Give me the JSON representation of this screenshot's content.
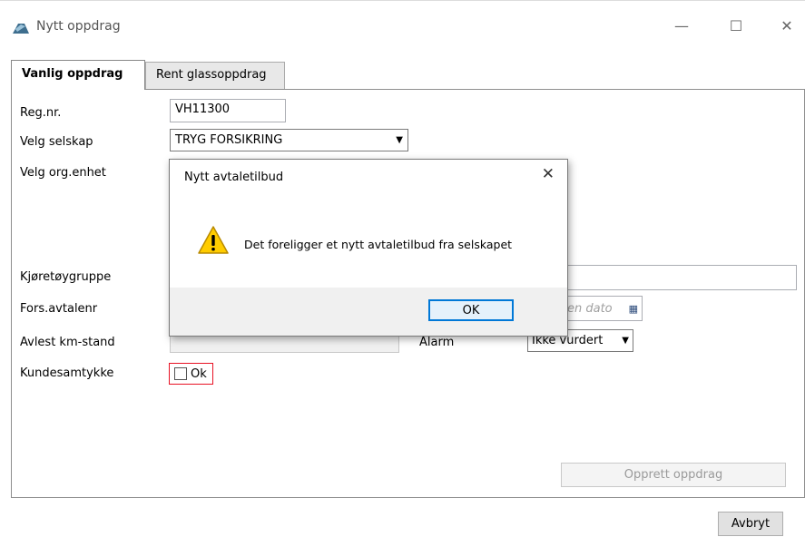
{
  "window": {
    "title": "Nytt oppdrag",
    "minimize_glyph": "—",
    "maximize_glyph": "☐",
    "close_glyph": "✕"
  },
  "tabs": [
    {
      "label": "Vanlig oppdrag",
      "active": true
    },
    {
      "label": "Rent glassoppdrag",
      "active": false
    }
  ],
  "form": {
    "regnr_label": "Reg.nr.",
    "regnr_value": "VH11300",
    "selskap_label": "Velg selskap",
    "selskap_value": "TRYG FORSIKRING",
    "orgenhet_label": "Velg org.enhet",
    "kjoretoy_label": "Kjøretøygruppe",
    "forsavtale_label": "Fors.avtalenr",
    "dato_placeholder": "en dato",
    "km_label": "Avlest km-stand",
    "alarm_label": "Alarm",
    "alarm_value": "Ikke vurdert",
    "kundesamtykke_label": "Kundesamtykke",
    "ok_checkbox_label": "Ok",
    "create_button": "Opprett oppdrag"
  },
  "footer": {
    "cancel_button": "Avbryt"
  },
  "dialog": {
    "title": "Nytt avtaletilbud",
    "message": "Det foreligger et nytt avtaletilbud fra selskapet",
    "ok_button": "OK",
    "close_glyph": "✕"
  },
  "colors": {
    "highlight_border": "#e81123",
    "ok_focus": "#0078d7",
    "warning_yellow": "#ffcc00"
  }
}
